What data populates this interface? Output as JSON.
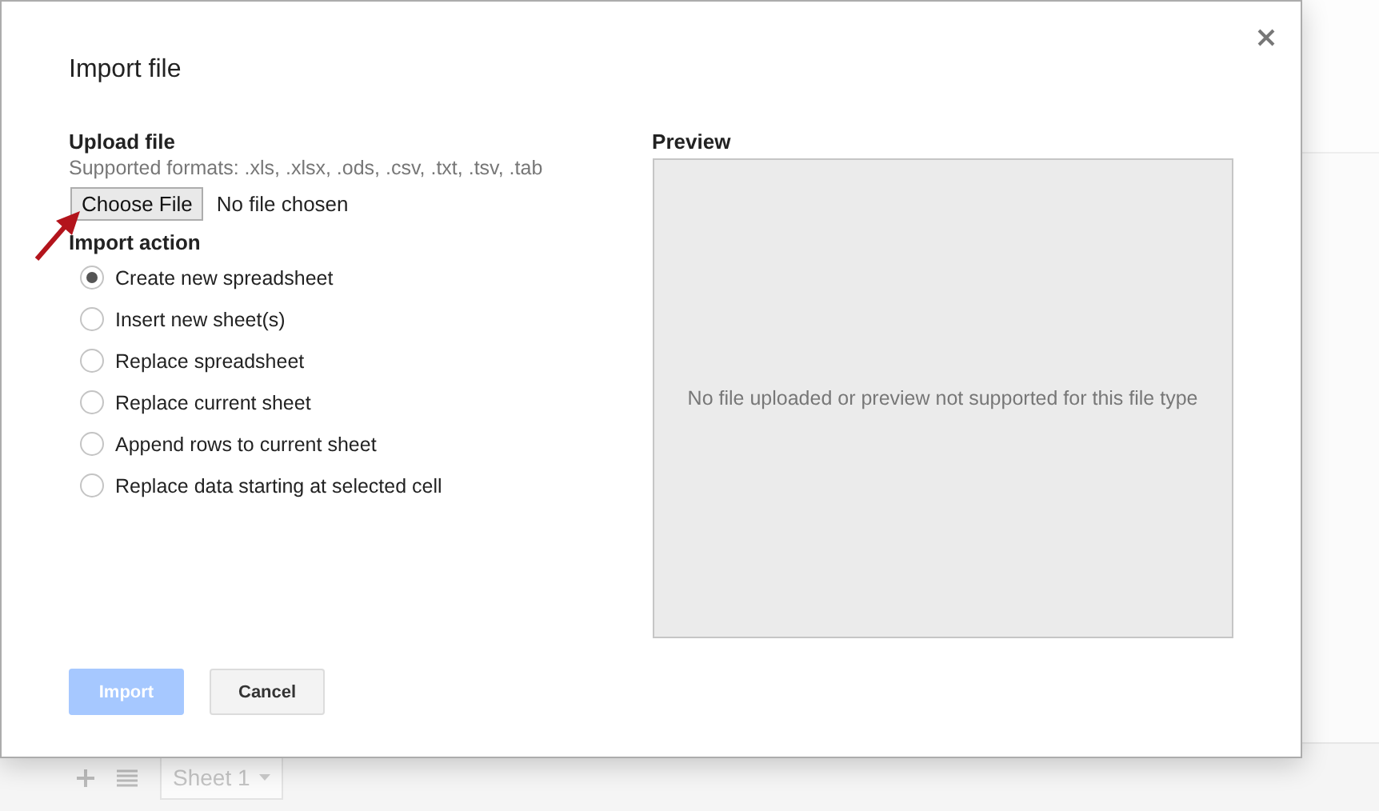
{
  "dialog": {
    "title": "Import file",
    "upload": {
      "heading": "Upload file",
      "formats": "Supported formats: .xls, .xlsx, .ods, .csv, .txt, .tsv, .tab",
      "button": "Choose File",
      "status": "No file chosen"
    },
    "import_action": {
      "heading": "Import action",
      "options": [
        {
          "label": "Create new spreadsheet",
          "selected": true
        },
        {
          "label": "Insert new sheet(s)",
          "selected": false
        },
        {
          "label": "Replace spreadsheet",
          "selected": false
        },
        {
          "label": "Replace current sheet",
          "selected": false
        },
        {
          "label": "Append rows to current sheet",
          "selected": false
        },
        {
          "label": "Replace data starting at selected cell",
          "selected": false
        }
      ]
    },
    "preview": {
      "heading": "Preview",
      "message": "No file uploaded or preview not supported for this file type"
    },
    "buttons": [
      {
        "label": "Import",
        "kind": "primary",
        "disabled": true
      },
      {
        "label": "Cancel",
        "kind": "secondary",
        "disabled": false
      }
    ]
  },
  "sheet_tabs": [
    {
      "label": "Sheet 1"
    }
  ]
}
